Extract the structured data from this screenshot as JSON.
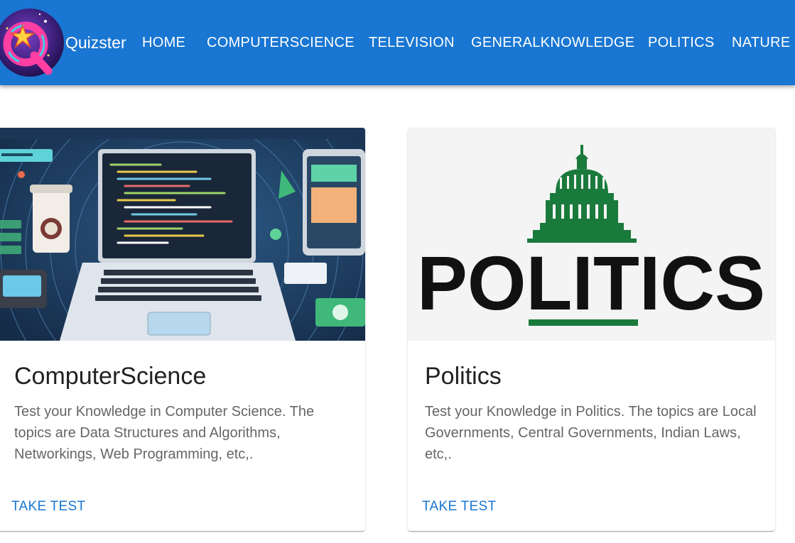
{
  "appbar": {
    "brand": "Quizster",
    "logo_icon": "quiz-logo-icon",
    "color": "#1976d2",
    "nav": [
      {
        "label": "HOME"
      },
      {
        "label": "COMPUTERSCIENCE"
      },
      {
        "label": "TELEVISION"
      },
      {
        "label": "GENERALKNOWLEDGE"
      },
      {
        "label": "POLITICS"
      },
      {
        "label": "NATURE"
      }
    ]
  },
  "cards": [
    {
      "title": "ComputerScience",
      "description": "Test your Knowledge in Computer Science. The topics are Data Structures and Algorithms, Networkings, Web Programming, etc,.",
      "action": "TAKE TEST",
      "image_icon": "laptop-illustration"
    },
    {
      "title": "Politics",
      "description": "Test your Knowledge in Politics. The topics are Local Governments, Central Governments, Indian Laws, etc,.",
      "action": "TAKE TEST",
      "image_text": "POLITICS",
      "image_icon": "capitol-dome-icon"
    }
  ],
  "colors": {
    "accent": "#1976d2",
    "politics_green": "#1a7a3c"
  }
}
